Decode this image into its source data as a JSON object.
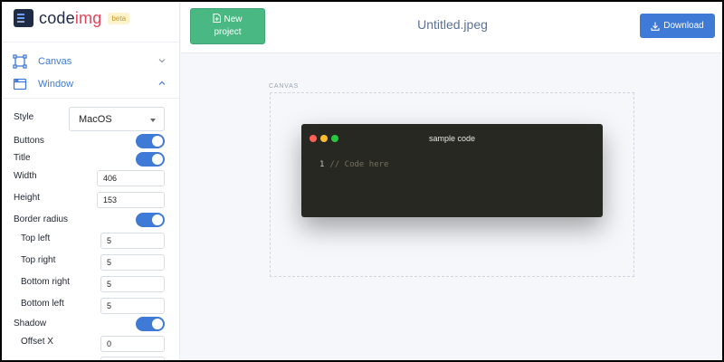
{
  "app": {
    "logo_main": "code",
    "logo_accent": "img",
    "badge": "beta"
  },
  "nav": {
    "canvas": {
      "label": "Canvas",
      "icon": "frame-icon",
      "expanded": false
    },
    "window": {
      "label": "Window",
      "icon": "window-icon",
      "expanded": true
    }
  },
  "settings": {
    "style_label": "Style",
    "style_value": "MacOS",
    "buttons_label": "Buttons",
    "buttons_on": true,
    "title_label": "Title",
    "title_on": true,
    "width_label": "Width",
    "width_value": "406",
    "height_label": "Height",
    "height_value": "153",
    "border_radius_label": "Border radius",
    "border_radius_on": true,
    "top_left_label": "Top left",
    "top_left_value": "5",
    "top_right_label": "Top right",
    "top_right_value": "5",
    "bottom_right_label": "Bottom right",
    "bottom_right_value": "5",
    "bottom_left_label": "Bottom left",
    "bottom_left_value": "5",
    "shadow_label": "Shadow",
    "shadow_on": true,
    "offset_x_label": "Offset X",
    "offset_x_value": "0"
  },
  "toolbar": {
    "new_project_line1": "New",
    "new_project_line2": "project",
    "filename": "Untitled.jpeg",
    "download_label": "Download"
  },
  "canvas": {
    "label": "CANVAS",
    "window_title": "sample code",
    "line_number": "1",
    "code": "// Code here"
  },
  "colors": {
    "accent": "#3f7ad6",
    "new_button": "#49b883",
    "editor_bg": "#272822",
    "dot_red": "#ff5f56",
    "dot_yellow": "#ffbd2e",
    "dot_green": "#27c93f"
  }
}
